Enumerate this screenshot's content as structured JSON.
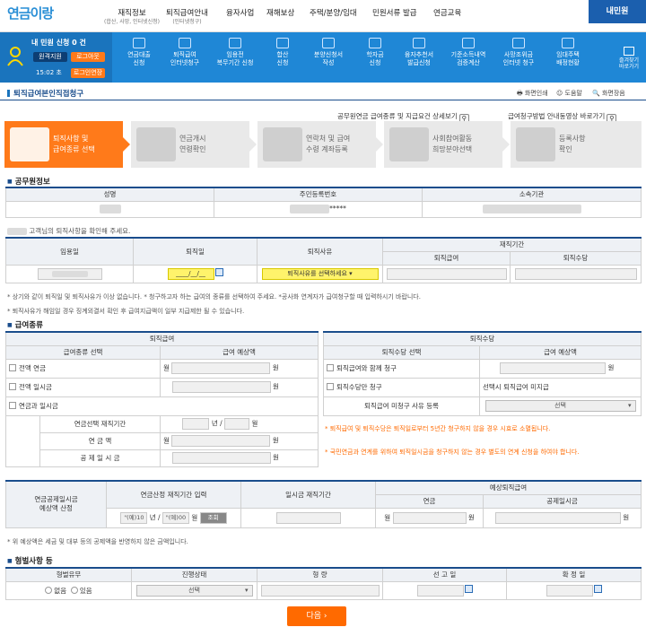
{
  "header": {
    "logo_text": "연금이랑",
    "menu": [
      {
        "label": "재직정보",
        "sub": "(합산, 사망, 인터넷신청)"
      },
      {
        "label": "퇴직급여안내",
        "sub": "(인터넷청구)"
      },
      {
        "label": "융자사업",
        "sub": ""
      },
      {
        "label": "재해보상",
        "sub": ""
      },
      {
        "label": "주택/분양/임대",
        "sub": ""
      },
      {
        "label": "민원서류 발급",
        "sub": ""
      },
      {
        "label": "연금교육",
        "sub": ""
      }
    ],
    "my_civil_label": "내민원"
  },
  "userbar": {
    "title": "내 민원 신청 0 건",
    "auth_label": "원격지원",
    "logout_label": "로그아웃",
    "session_time": "15:02 초",
    "extend_label": "로그인연장",
    "services": [
      {
        "label": "연금대출\n신청",
        "icon": "document-icon"
      },
      {
        "label": "퇴직급여\n인터넷청구",
        "icon": "computer-icon"
      },
      {
        "label": "임용전\n복무기간 신청",
        "icon": "calendar-icon"
      },
      {
        "label": "합산\n신청",
        "icon": "plus-icon"
      },
      {
        "label": "분양신청서\n작성",
        "icon": "house-icon"
      },
      {
        "label": "학자금\n신청",
        "icon": "graduation-icon"
      },
      {
        "label": "융자추천서\n발급신청",
        "icon": "paper-icon"
      },
      {
        "label": "기준소득내역\n검증계산",
        "icon": "chart-icon"
      },
      {
        "label": "사망조위금\n인터넷 청구",
        "icon": "card-icon"
      },
      {
        "label": "임대주택\n배정현황",
        "icon": "building-icon"
      }
    ],
    "favorite_label": "즐겨찾기\n바로가기"
  },
  "page": {
    "title": "퇴직급여본인직접청구",
    "tools": [
      "화면인쇄",
      "도움말",
      "화면장음"
    ],
    "guide_link1": "공무원연금 급여종류 및 지급요건 상세보기",
    "guide_link2": "급여청구방법 안내동영상 바로가기"
  },
  "steps": [
    {
      "label": "퇴직사항 및\n급여종류 선택",
      "active": true
    },
    {
      "label": "연금개시\n연령확인",
      "active": false
    },
    {
      "label": "연락처 및 급여\n수령 계좌등록",
      "active": false
    },
    {
      "label": "사회참여활동\n희망분야선택",
      "active": false
    },
    {
      "label": "등록사항\n확인",
      "active": false
    }
  ],
  "official": {
    "section": "공무원정보",
    "headers": [
      "성명",
      "주민등록번호",
      "소속기관"
    ],
    "ssn_suffix": "*****"
  },
  "retire": {
    "notice": "고객님의 퇴직사항을 확인해 주세요.",
    "headers": [
      "임용일",
      "퇴직일",
      "퇴직사유",
      "재직기간"
    ],
    "sub_headers": [
      "퇴직급여",
      "퇴직수당"
    ],
    "retire_date": "____/__/__",
    "reason_placeholder": "퇴직사유를 선택하세요",
    "note1": "* 상기와 같이 퇴직일 및 퇴직사유가 이상 없습니다.  * 청구하고자 하는 급여의 종류를 선택하여 주세요.  *공사화 연계자가 급여청구할 때 입력하시기 바랍니다.",
    "note2": "* 퇴직사유가 해임일 경우 징계외결서 확인 후 급여지급액이 일부 지급제한 될 수 있습니다."
  },
  "benefit": {
    "section": "급여종류",
    "left_title": "퇴직급여",
    "right_title": "퇴직수당",
    "left_headers": [
      "급여종류 선택",
      "급여 예상액"
    ],
    "right_headers": [
      "퇴직수당 선택",
      "급여 예상액"
    ],
    "left_options": [
      "전액 연금",
      "전액 일시금",
      "연금과 일시금"
    ],
    "won": "원",
    "won_prefix": "월",
    "right_options": [
      "퇴직급여와 함께 청구",
      "퇴직수당만 청구"
    ],
    "right_unpaid": "선택시 퇴직급여 미지급",
    "right_reason_label": "퇴직급여 미청구 사유 등록",
    "right_reason_select": "선택",
    "mix_period_label": "연금선택 재직기간",
    "year": "년 /",
    "month": "월",
    "pension_label": "연   금   액",
    "deduct_label": "공 제 일 시 금",
    "notice1": "* 퇴직급여 및 퇴직수당은 퇴직일로부터 5년간 청구하지 않을 경우 시효로 소멸됩니다.",
    "notice2": "* 국민연금과 연계를 위하여 퇴직일시금을 청구하지 않는 경우 별도의 연계 신청을 하여야 합니다."
  },
  "calc": {
    "row_label": "연금공제일시금\n예상액 산정",
    "headers": [
      "연금산정 재직기간 입력",
      "일시금 재직기간",
      "예상퇴직급여"
    ],
    "sub_headers": [
      "연금",
      "공제일시금"
    ],
    "year_placeholder": "\"(예)10",
    "year_unit": "년 /",
    "month_placeholder": "\"(예)00",
    "month_unit": "월",
    "lookup_label": "조회",
    "won_prefix": "월",
    "won": "원",
    "note": "* 위 예상액은 세금 및 대부 등의 공제액을 반영하지 않은 금액입니다."
  },
  "penalty": {
    "section": "형벌사항 등",
    "headers": [
      "형벌유무",
      "진행상태",
      "형   량",
      "선 고 일",
      "확 정 일"
    ],
    "opt_no": "없음",
    "opt_yes": "있음",
    "status_select": "선택"
  },
  "next_label": "다음"
}
